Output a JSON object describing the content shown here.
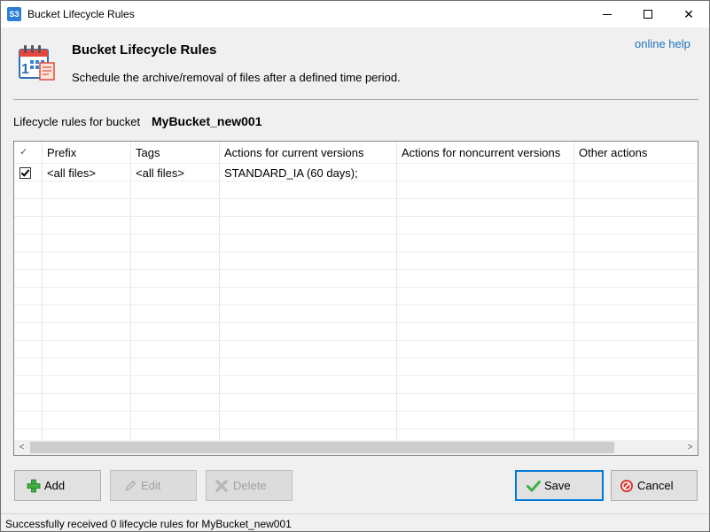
{
  "window": {
    "title": "Bucket Lifecycle Rules",
    "app_icon_text": "S3",
    "controls": {
      "minimize": "",
      "maximize": "",
      "close": "✕"
    }
  },
  "header": {
    "title": "Bucket Lifecycle Rules",
    "description": "Schedule the archive/removal of files after a defined time period.",
    "help_link": "online help"
  },
  "bucket": {
    "label": "Lifecycle rules for bucket",
    "name": "MyBucket_new001"
  },
  "grid": {
    "columns": [
      {
        "label": "✓"
      },
      {
        "label": "Prefix"
      },
      {
        "label": "Tags"
      },
      {
        "label": "Actions for current versions"
      },
      {
        "label": "Actions for noncurrent versions"
      },
      {
        "label": "Other actions"
      }
    ],
    "rows": [
      {
        "checked": true,
        "prefix": "<all files>",
        "tags": "<all files>",
        "current_actions": "STANDARD_IA (60 days);",
        "noncurrent_actions": "",
        "other_actions": ""
      }
    ],
    "scroll_left_arrow": "<",
    "scroll_right_arrow": ">"
  },
  "buttons": {
    "add": "Add",
    "edit": "Edit",
    "delete": "Delete",
    "save": "Save",
    "cancel": "Cancel"
  },
  "icons": {
    "add": "plus-icon",
    "edit": "pencil-icon",
    "delete": "delete-icon",
    "save": "checkmark-icon",
    "cancel": "cancel-icon",
    "header": "calendar-icon"
  },
  "colors": {
    "accent": "#0078d7",
    "link": "#1e73be",
    "add_green": "#3cb043",
    "cancel_red": "#d9312a"
  },
  "status": {
    "text": "Successfully received 0 lifecycle rules for MyBucket_new001"
  }
}
